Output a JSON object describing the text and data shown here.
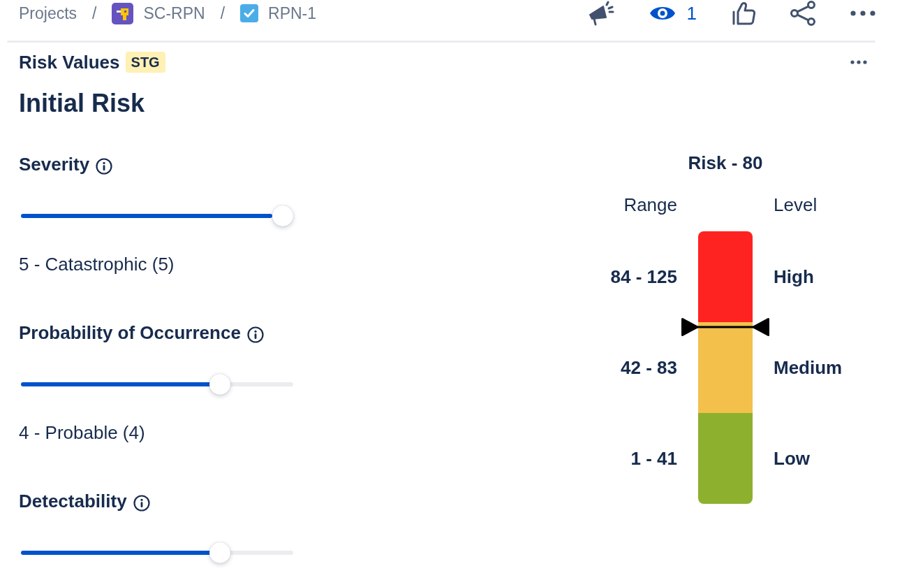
{
  "top_bar": {
    "breadcrumbs": [
      {
        "kind": "text",
        "label": "Projects"
      },
      {
        "kind": "project",
        "separator": "/",
        "label": "SC-RPN"
      },
      {
        "kind": "issue",
        "separator": "/",
        "label": "RPN-1"
      }
    ],
    "watch_count": "1"
  },
  "panel": {
    "title": "Risk Values",
    "badge": "STG",
    "heading": "Initial Risk"
  },
  "fields": [
    {
      "label": "Severity",
      "level": 1,
      "value": "5 - Catastrophic (5)"
    },
    {
      "label": "Probability of Occurrence",
      "level": 0.75,
      "value": "4 - Probable (4)"
    },
    {
      "label": "Detectability",
      "level": 0.75
    }
  ],
  "risk_meter": {
    "title": "Risk - 80",
    "range_header": "Range",
    "level_header": "Level",
    "level": 0.65,
    "bands": [
      {
        "range": "84 - 125",
        "name": "High",
        "color": "#fe2320"
      },
      {
        "range": "42 - 83",
        "name": "Medium",
        "color": "#f3c14b"
      },
      {
        "range": "1 - 41",
        "name": "Low",
        "color": "#8db12e"
      }
    ]
  }
}
